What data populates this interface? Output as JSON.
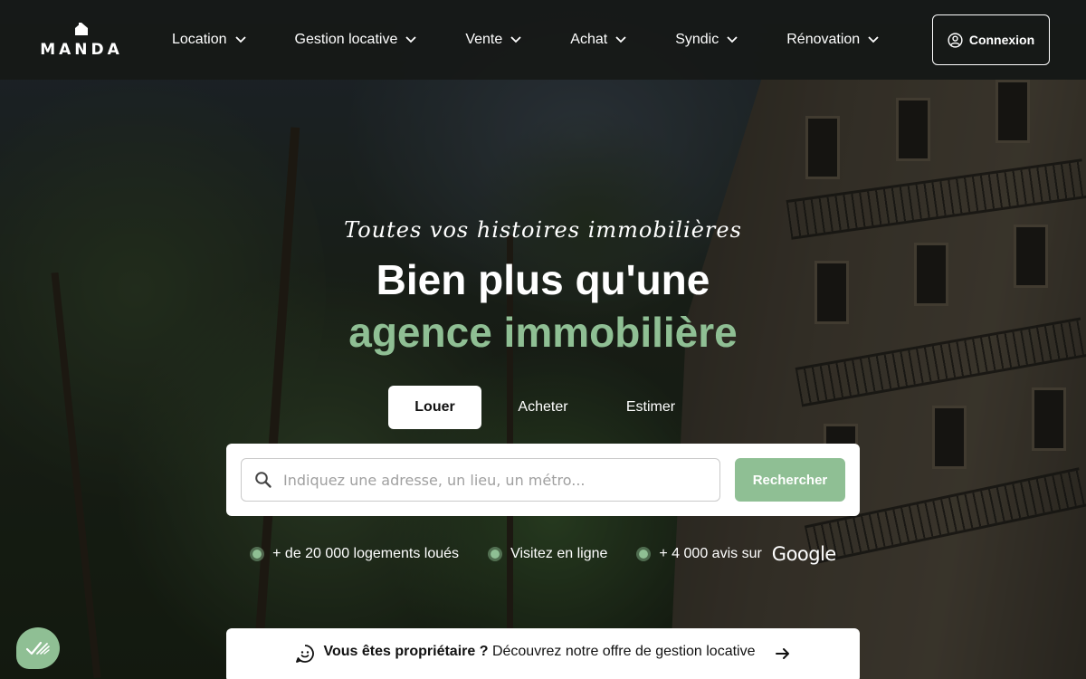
{
  "brand": {
    "name": "MANDA",
    "accent": "#8fbf94"
  },
  "nav": {
    "items": [
      {
        "label": "Location"
      },
      {
        "label": "Gestion locative"
      },
      {
        "label": "Vente"
      },
      {
        "label": "Achat"
      },
      {
        "label": "Syndic"
      },
      {
        "label": "Rénovation"
      }
    ],
    "login_label": "Connexion"
  },
  "hero": {
    "tagline": "Toutes vos histoires immobilières",
    "headline_line1": "Bien plus qu'une",
    "headline_line2": "agence immobilière"
  },
  "tabs": [
    {
      "label": "Louer",
      "active": true
    },
    {
      "label": "Acheter",
      "active": false
    },
    {
      "label": "Estimer",
      "active": false
    }
  ],
  "search": {
    "placeholder": "Indiquez une adresse, un lieu, un métro...",
    "value": "",
    "button_label": "Rechercher"
  },
  "features": [
    {
      "text": "+ de 20 000 logements loués"
    },
    {
      "text": "Visitez en ligne"
    },
    {
      "text": "+ 4 000 avis sur",
      "logo": "Google"
    }
  ],
  "owner_banner": {
    "bold": "Vous êtes propriétaire ?",
    "text": " Découvrez notre offre de gestion locative"
  },
  "icons": {
    "logo_mark": "house-icon",
    "nav_chevron": "chevron-down-icon",
    "login": "user-circle-icon",
    "search": "search-icon",
    "owner": "smiley-icon",
    "owner_arrow": "arrow-right-icon",
    "widget": "checkmarks-icon"
  }
}
